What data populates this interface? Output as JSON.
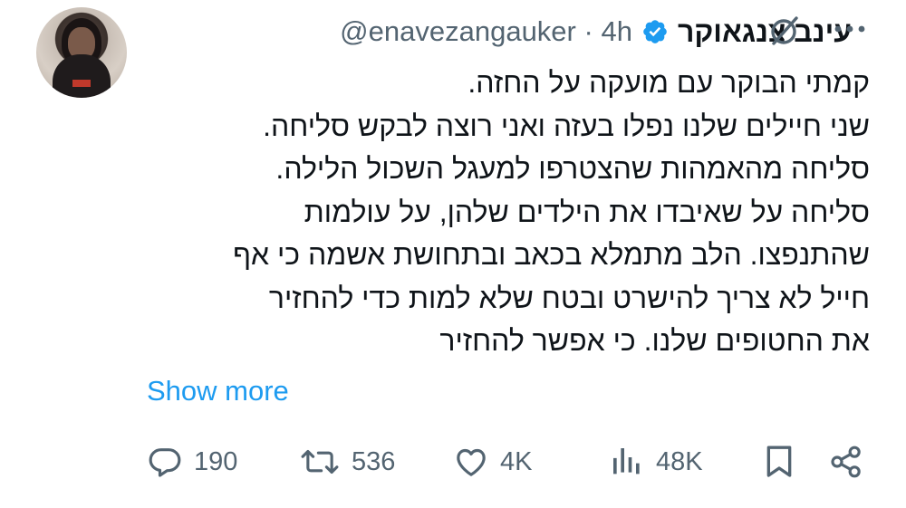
{
  "author": {
    "name": "עינב צנגאוקר",
    "handle": "@enavezangauker",
    "separator": "·",
    "time": "4h"
  },
  "tweet": {
    "lines": [
      "קמתי הבוקר עם מועקה על החזה.",
      "שני חיילים שלנו נפלו בעזה ואני רוצה לבקש סליחה.",
      "סליחה מהאמהות שהצטרפו למעגל השכול הלילה.",
      "סליחה על שאיבדו את הילדים שלהן, על עולמות",
      "שהתנפצו. הלב מתמלא בכאב ובתחושת אשמה כי אף",
      "חייל לא צריך להישרט ובטח שלא למות כדי להחזיר",
      "את החטופים שלנו. כי אפשר להחזיר"
    ],
    "show_more": "Show more"
  },
  "actions": {
    "replies": "190",
    "reposts": "536",
    "likes": "4K",
    "views": "48K"
  },
  "colors": {
    "verified": "#1d9bf0",
    "link": "#1d9bf0",
    "muted": "#536471"
  }
}
